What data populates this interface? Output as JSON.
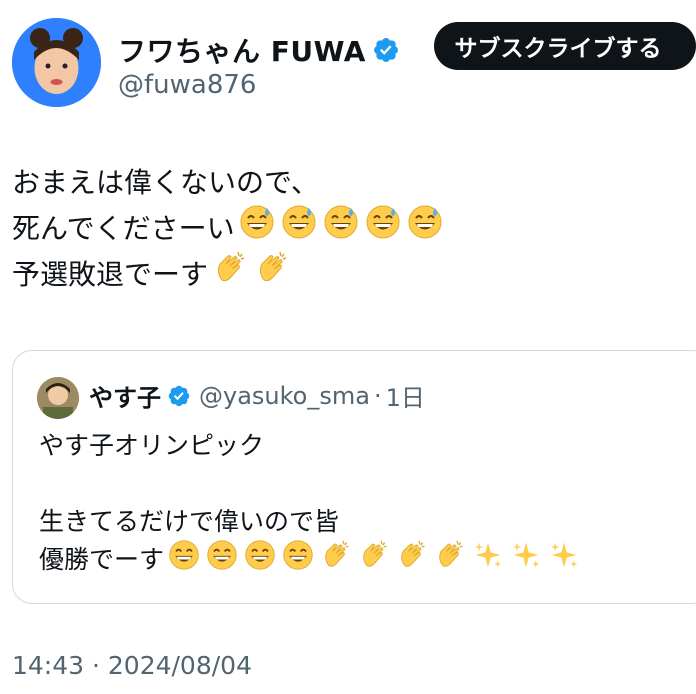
{
  "author": {
    "display_name": "フワちゃん FUWA",
    "handle": "@fuwa876",
    "verified_icon": "verified-badge-icon",
    "avatar_icon": "avatar"
  },
  "subscribe_button": {
    "label": "サブスクライブする"
  },
  "tweet": {
    "line1": "おまえは偉くないので、",
    "line2_text": "死んでくださーい",
    "line2_emojis": [
      "sweat-smile",
      "sweat-smile",
      "sweat-smile",
      "sweat-smile",
      "sweat-smile"
    ],
    "line3_text": "予選敗退でーす",
    "line3_emojis": [
      "clap",
      "clap"
    ]
  },
  "quoted_tweet": {
    "display_name": "やす子",
    "handle": "@yasuko_sma",
    "separator": "·",
    "age": "1日",
    "line1": "やす子オリンピック",
    "line2": "生きてるだけで偉いので皆",
    "line3_text": "優勝でーす",
    "line3_emojis": [
      "grin",
      "grin",
      "grin",
      "grin",
      "clap",
      "clap",
      "clap",
      "clap",
      "sparkles",
      "sparkles",
      "sparkles"
    ]
  },
  "timestamp": "14:43 · 2024/08/04",
  "colors": {
    "accent_blue": "#1d9bf0",
    "button_bg": "#0f1419",
    "secondary_text": "#536471",
    "border": "#cfd9de"
  }
}
